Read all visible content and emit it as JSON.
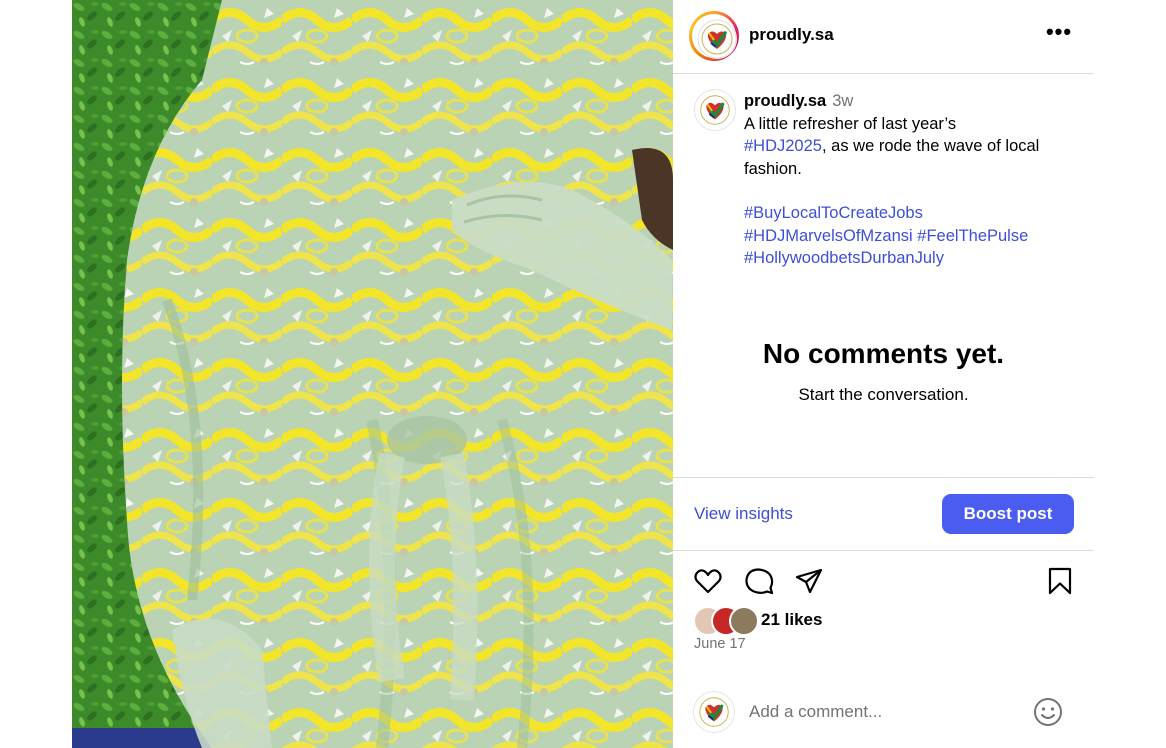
{
  "post": {
    "username": "proudly.sa",
    "more_label": "•••",
    "time_ago": "3w",
    "caption": {
      "line1": "A little refresher of last year’s",
      "tag1": "#HDJ2025",
      "line2": ", as we rode the wave of local fashion.",
      "tag2": "#BuyLocalToCreateJobs",
      "tag3": "#HDJMarvelsOfMzansi",
      "tag4": "#FeelThePulse",
      "tag5": "#HollywoodbetsDurbanJuly"
    }
  },
  "comments": {
    "empty_title": "No comments yet.",
    "empty_subtitle": "Start the conversation."
  },
  "insights": {
    "view_label": "View insights",
    "boost_label": "Boost post"
  },
  "actions": {
    "icons": [
      "heart-icon",
      "comment-icon",
      "share-icon",
      "bookmark-icon"
    ]
  },
  "likes_label": "21 likes",
  "date": "June 17",
  "comment_box": {
    "placeholder": "Add a comment...",
    "emoji_icon": "smiley-icon"
  },
  "colors": {
    "link": "#3d4fd6",
    "boost_button": "#4a5df0",
    "muted": "#737373",
    "divider": "#dbdbdb"
  }
}
